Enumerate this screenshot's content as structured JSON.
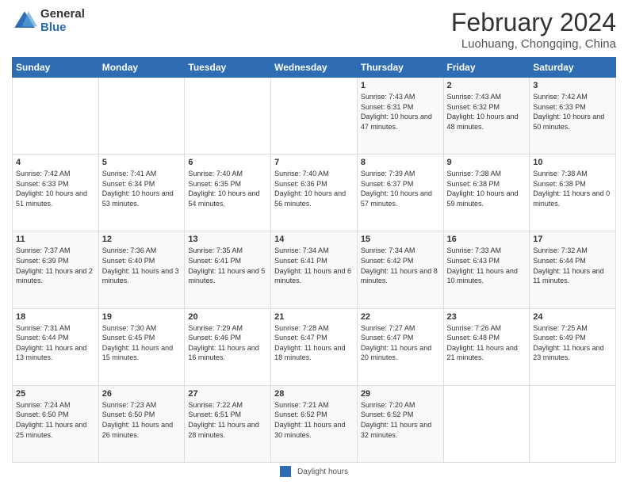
{
  "logo": {
    "general": "General",
    "blue": "Blue"
  },
  "header": {
    "month_year": "February 2024",
    "location": "Luohuang, Chongqing, China"
  },
  "days_of_week": [
    "Sunday",
    "Monday",
    "Tuesday",
    "Wednesday",
    "Thursday",
    "Friday",
    "Saturday"
  ],
  "weeks": [
    [
      {
        "day": "",
        "sunrise": "",
        "sunset": "",
        "daylight": ""
      },
      {
        "day": "",
        "sunrise": "",
        "sunset": "",
        "daylight": ""
      },
      {
        "day": "",
        "sunrise": "",
        "sunset": "",
        "daylight": ""
      },
      {
        "day": "",
        "sunrise": "",
        "sunset": "",
        "daylight": ""
      },
      {
        "day": "1",
        "sunrise": "Sunrise: 7:43 AM",
        "sunset": "Sunset: 6:31 PM",
        "daylight": "Daylight: 10 hours and 47 minutes."
      },
      {
        "day": "2",
        "sunrise": "Sunrise: 7:43 AM",
        "sunset": "Sunset: 6:32 PM",
        "daylight": "Daylight: 10 hours and 48 minutes."
      },
      {
        "day": "3",
        "sunrise": "Sunrise: 7:42 AM",
        "sunset": "Sunset: 6:33 PM",
        "daylight": "Daylight: 10 hours and 50 minutes."
      }
    ],
    [
      {
        "day": "4",
        "sunrise": "Sunrise: 7:42 AM",
        "sunset": "Sunset: 6:33 PM",
        "daylight": "Daylight: 10 hours and 51 minutes."
      },
      {
        "day": "5",
        "sunrise": "Sunrise: 7:41 AM",
        "sunset": "Sunset: 6:34 PM",
        "daylight": "Daylight: 10 hours and 53 minutes."
      },
      {
        "day": "6",
        "sunrise": "Sunrise: 7:40 AM",
        "sunset": "Sunset: 6:35 PM",
        "daylight": "Daylight: 10 hours and 54 minutes."
      },
      {
        "day": "7",
        "sunrise": "Sunrise: 7:40 AM",
        "sunset": "Sunset: 6:36 PM",
        "daylight": "Daylight: 10 hours and 56 minutes."
      },
      {
        "day": "8",
        "sunrise": "Sunrise: 7:39 AM",
        "sunset": "Sunset: 6:37 PM",
        "daylight": "Daylight: 10 hours and 57 minutes."
      },
      {
        "day": "9",
        "sunrise": "Sunrise: 7:38 AM",
        "sunset": "Sunset: 6:38 PM",
        "daylight": "Daylight: 10 hours and 59 minutes."
      },
      {
        "day": "10",
        "sunrise": "Sunrise: 7:38 AM",
        "sunset": "Sunset: 6:38 PM",
        "daylight": "Daylight: 11 hours and 0 minutes."
      }
    ],
    [
      {
        "day": "11",
        "sunrise": "Sunrise: 7:37 AM",
        "sunset": "Sunset: 6:39 PM",
        "daylight": "Daylight: 11 hours and 2 minutes."
      },
      {
        "day": "12",
        "sunrise": "Sunrise: 7:36 AM",
        "sunset": "Sunset: 6:40 PM",
        "daylight": "Daylight: 11 hours and 3 minutes."
      },
      {
        "day": "13",
        "sunrise": "Sunrise: 7:35 AM",
        "sunset": "Sunset: 6:41 PM",
        "daylight": "Daylight: 11 hours and 5 minutes."
      },
      {
        "day": "14",
        "sunrise": "Sunrise: 7:34 AM",
        "sunset": "Sunset: 6:41 PM",
        "daylight": "Daylight: 11 hours and 6 minutes."
      },
      {
        "day": "15",
        "sunrise": "Sunrise: 7:34 AM",
        "sunset": "Sunset: 6:42 PM",
        "daylight": "Daylight: 11 hours and 8 minutes."
      },
      {
        "day": "16",
        "sunrise": "Sunrise: 7:33 AM",
        "sunset": "Sunset: 6:43 PM",
        "daylight": "Daylight: 11 hours and 10 minutes."
      },
      {
        "day": "17",
        "sunrise": "Sunrise: 7:32 AM",
        "sunset": "Sunset: 6:44 PM",
        "daylight": "Daylight: 11 hours and 11 minutes."
      }
    ],
    [
      {
        "day": "18",
        "sunrise": "Sunrise: 7:31 AM",
        "sunset": "Sunset: 6:44 PM",
        "daylight": "Daylight: 11 hours and 13 minutes."
      },
      {
        "day": "19",
        "sunrise": "Sunrise: 7:30 AM",
        "sunset": "Sunset: 6:45 PM",
        "daylight": "Daylight: 11 hours and 15 minutes."
      },
      {
        "day": "20",
        "sunrise": "Sunrise: 7:29 AM",
        "sunset": "Sunset: 6:46 PM",
        "daylight": "Daylight: 11 hours and 16 minutes."
      },
      {
        "day": "21",
        "sunrise": "Sunrise: 7:28 AM",
        "sunset": "Sunset: 6:47 PM",
        "daylight": "Daylight: 11 hours and 18 minutes."
      },
      {
        "day": "22",
        "sunrise": "Sunrise: 7:27 AM",
        "sunset": "Sunset: 6:47 PM",
        "daylight": "Daylight: 11 hours and 20 minutes."
      },
      {
        "day": "23",
        "sunrise": "Sunrise: 7:26 AM",
        "sunset": "Sunset: 6:48 PM",
        "daylight": "Daylight: 11 hours and 21 minutes."
      },
      {
        "day": "24",
        "sunrise": "Sunrise: 7:25 AM",
        "sunset": "Sunset: 6:49 PM",
        "daylight": "Daylight: 11 hours and 23 minutes."
      }
    ],
    [
      {
        "day": "25",
        "sunrise": "Sunrise: 7:24 AM",
        "sunset": "Sunset: 6:50 PM",
        "daylight": "Daylight: 11 hours and 25 minutes."
      },
      {
        "day": "26",
        "sunrise": "Sunrise: 7:23 AM",
        "sunset": "Sunset: 6:50 PM",
        "daylight": "Daylight: 11 hours and 26 minutes."
      },
      {
        "day": "27",
        "sunrise": "Sunrise: 7:22 AM",
        "sunset": "Sunset: 6:51 PM",
        "daylight": "Daylight: 11 hours and 28 minutes."
      },
      {
        "day": "28",
        "sunrise": "Sunrise: 7:21 AM",
        "sunset": "Sunset: 6:52 PM",
        "daylight": "Daylight: 11 hours and 30 minutes."
      },
      {
        "day": "29",
        "sunrise": "Sunrise: 7:20 AM",
        "sunset": "Sunset: 6:52 PM",
        "daylight": "Daylight: 11 hours and 32 minutes."
      },
      {
        "day": "",
        "sunrise": "",
        "sunset": "",
        "daylight": ""
      },
      {
        "day": "",
        "sunrise": "",
        "sunset": "",
        "daylight": ""
      }
    ]
  ],
  "footer": {
    "daylight_label": "Daylight hours"
  }
}
